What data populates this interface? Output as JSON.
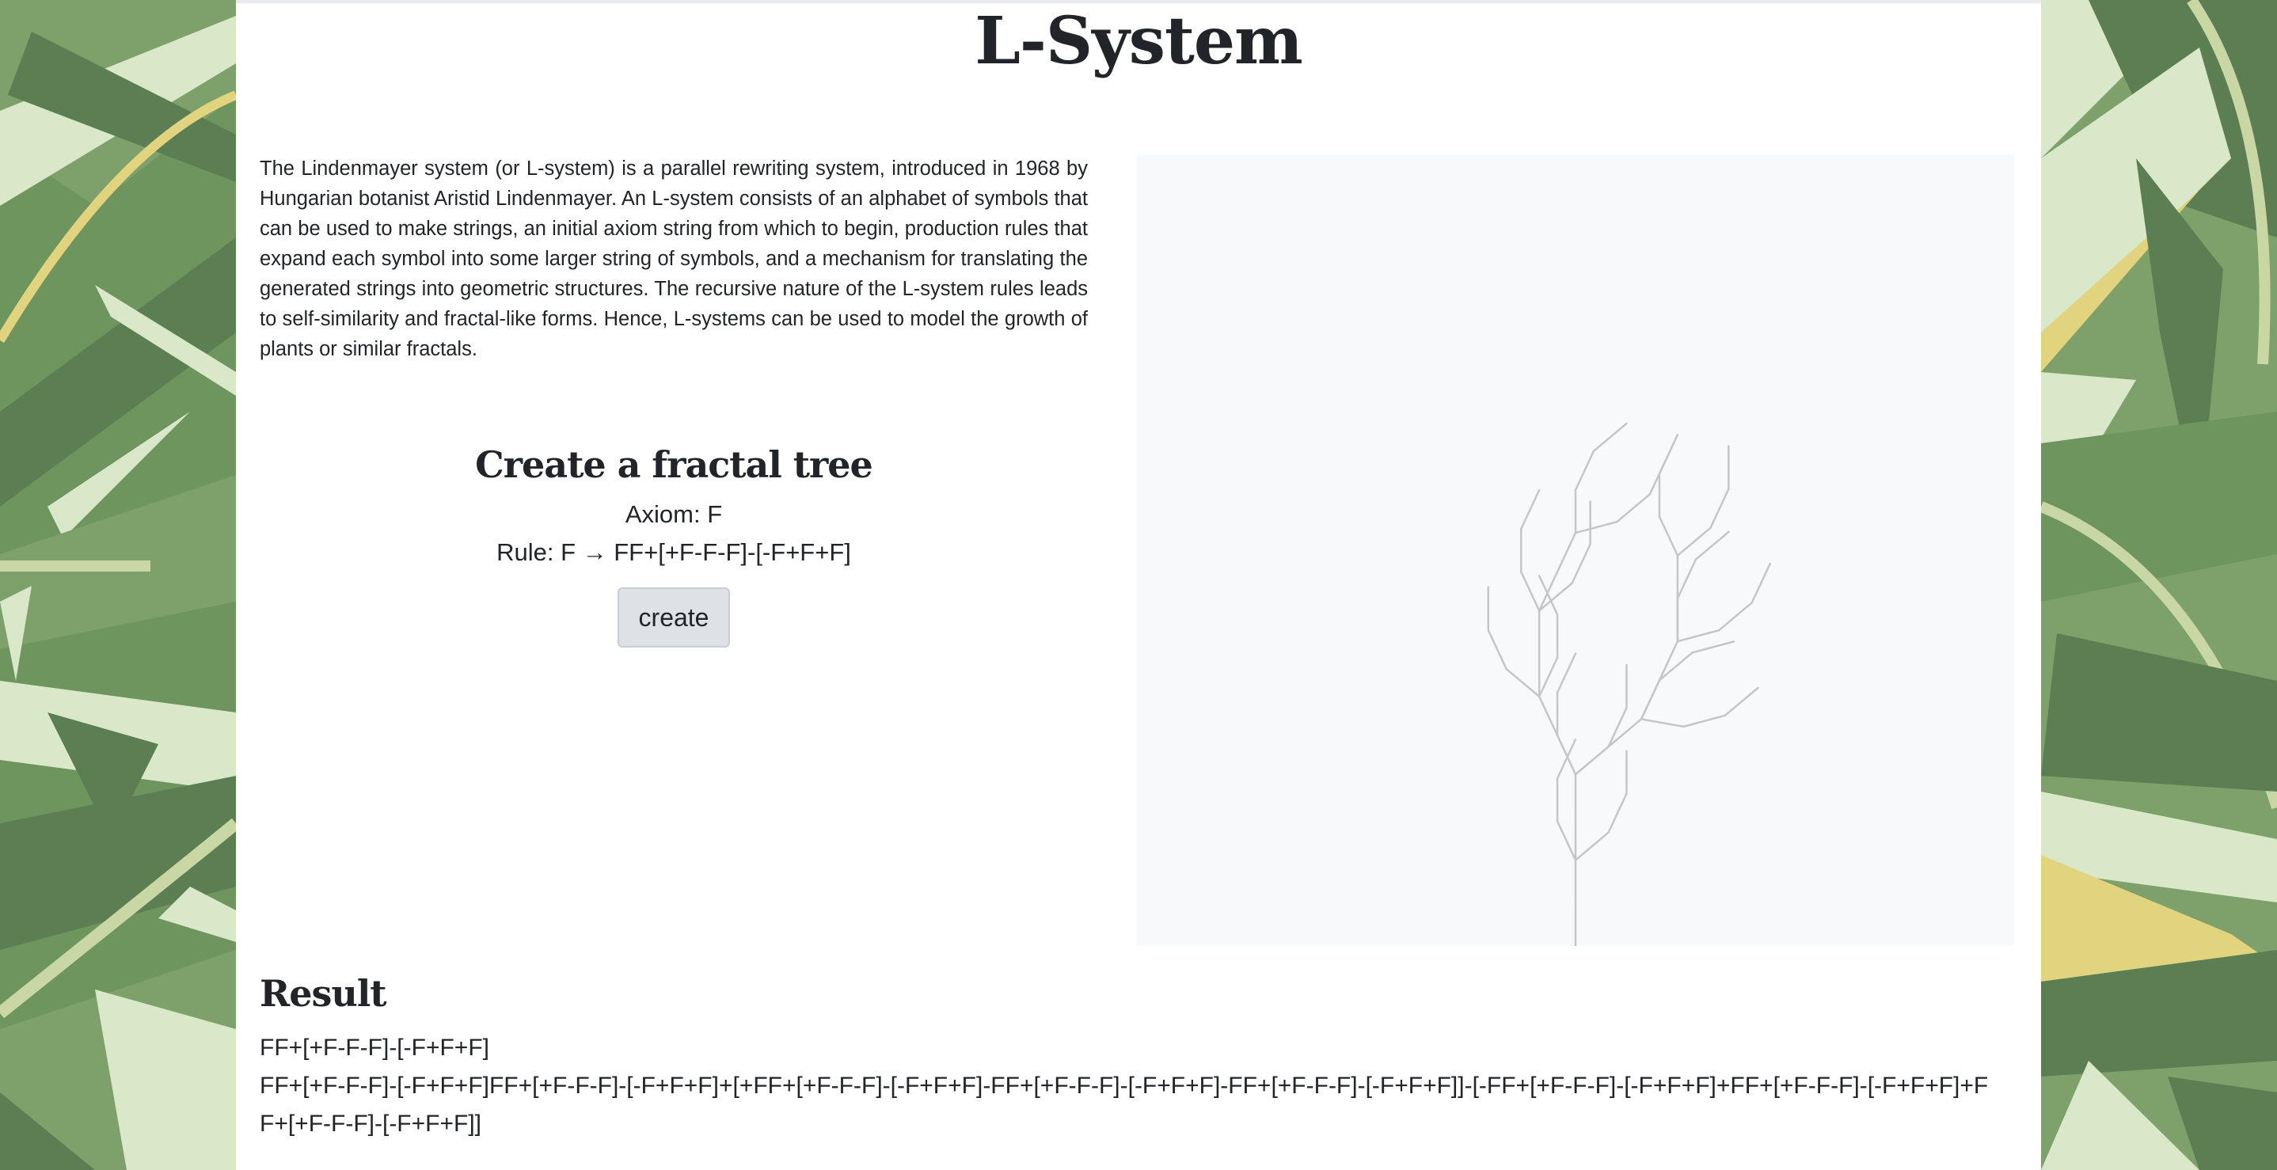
{
  "page": {
    "title": "L-System",
    "intro": "The Lindenmayer system (or L-system) is a parallel rewriting system, introduced in 1968 by Hungarian botanist Aristid Lindenmayer. An L-system consists of an alphabet of symbols that can be used to make strings, an initial axiom string from which to begin, production rules that expand each symbol into some larger string of symbols, and a mechanism for translating the generated strings into geometric structures. The recursive nature of the L-system rules leads to self-similarity and fractal-like forms. Hence, L-systems can be used to model the growth of plants or similar fractals."
  },
  "creator": {
    "heading": "Create a fractal tree",
    "axiom": "Axiom: F",
    "rule": "Rule: F → FF+[+F-F-F]-[-F+F+F]",
    "button_label": "create"
  },
  "canvas": {
    "background": "#f8f9fa",
    "stroke": "#c4c6c8",
    "axiom": "F",
    "rule_from": "F",
    "rule_to": "FF+[+F-F-F]-[-F+F+F]",
    "angle_deg": 25,
    "iterations": 2
  },
  "result": {
    "heading": "Result",
    "generations": [
      "FF+[+F-F-F]-[-F+F+F]",
      "FF+[+F-F-F]-[-F+F+F]FF+[+F-F-F]-[-F+F+F]+[+FF+[+F-F-F]-[-F+F+F]-FF+[+F-F-F]-[-F+F+F]-FF+[+F-F-F]-[-F+F+F]]-[-FF+[+F-F-F]-[-F+F+F]+FF+[+F-F-F]-[-F+F+F]+FF+[+F-F-F]-[-F+F+F]]"
    ]
  },
  "colors": {
    "text": "#212529",
    "button_bg": "#dee2e6",
    "leaf_dark": "#5b7f52",
    "leaf_mid": "#7ea06a",
    "leaf_light": "#d8e8c8",
    "leaf_yellow": "#e2d47e"
  }
}
